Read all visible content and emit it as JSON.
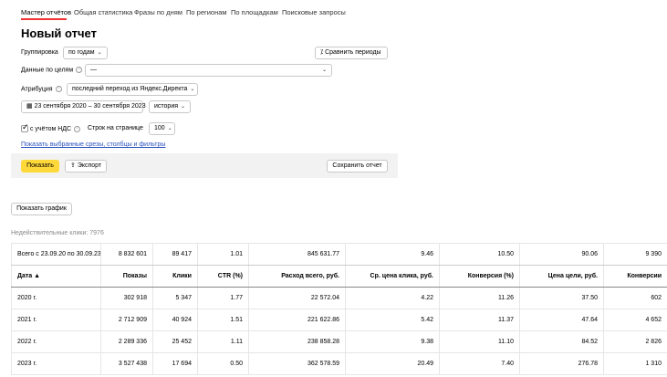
{
  "tabs": [
    {
      "label": "Мастер отчётов"
    },
    {
      "label": "Общая статистика"
    },
    {
      "label": "Фразы по дням"
    },
    {
      "label": "По регионам"
    },
    {
      "label": "По площадкам"
    },
    {
      "label": "Поисковые запросы"
    }
  ],
  "form": {
    "title": "Новый отчет",
    "grouping_label": "Группировка",
    "grouping_value": "по годам",
    "compare_button": "Сравнить периоды",
    "goals_label": "Данные по целям",
    "goals_value": "—",
    "attribution_label": "Атрибуция",
    "attribution_value": "последний переход из Яндекс.Директа",
    "date_range": "23 сентября 2020 – 30 сентября 2023",
    "history_value": "история",
    "vat_label": "с учётом НДС",
    "rows_label": "Строк на странице",
    "rows_value": "100",
    "show_slices_link": "Показать выбранные срезы, столбцы и фильтры",
    "show_button": "Показать",
    "export_button": "Экспорт",
    "save_button": "Сохранить отчет"
  },
  "show_chart_button": "Показать график",
  "invalid_clicks": "Недействительные клики: 7976",
  "table": {
    "total_row": [
      "Всего с 23.09.20 по 30.09.23",
      "8 832 601",
      "89 417",
      "1.01",
      "845 631.77",
      "9.46",
      "10.50",
      "90.06",
      "9 390"
    ],
    "headers": [
      "Дата ▲",
      "Показы",
      "Клики",
      "CTR (%)",
      "Расход всего, руб.",
      "Ср. цена клика, руб.",
      "Конверсия (%)",
      "Цена цели, руб.",
      "Конверсии"
    ],
    "rows": [
      [
        "2020 г.",
        "302 918",
        "5 347",
        "1.77",
        "22 572.04",
        "4.22",
        "11.26",
        "37.50",
        "602"
      ],
      [
        "2021 г.",
        "2 712 909",
        "40 924",
        "1.51",
        "221 622.86",
        "5.42",
        "11.37",
        "47.64",
        "4 652"
      ],
      [
        "2022 г.",
        "2 289 336",
        "25 452",
        "1.11",
        "238 858.28",
        "9.38",
        "11.10",
        "84.52",
        "2 826"
      ],
      [
        "2023 г.",
        "3 527 438",
        "17 694",
        "0.50",
        "362 578.59",
        "20.49",
        "7.40",
        "276.78",
        "1 310"
      ]
    ]
  }
}
